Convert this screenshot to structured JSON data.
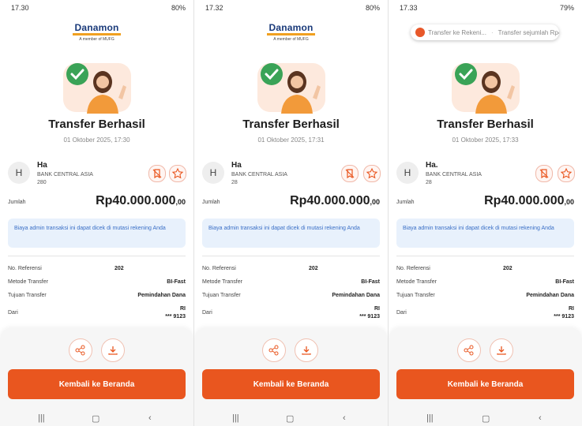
{
  "panels": [
    {
      "status": {
        "time": "17.30",
        "battery": "80%"
      },
      "header_type": "logo",
      "logo": {
        "brand": "Danamon",
        "sub": "A member of MUFG"
      },
      "title": "Transfer Berhasil",
      "datetime": "01 Oktober 2025, 17:30",
      "recipient": {
        "initial": "H",
        "name": "Ha",
        "bank": "BANK CENTRAL ASIA",
        "account": "280"
      },
      "amount_label": "Jumlah",
      "amount": "Rp40.000.000",
      "amount_decimals": ",00",
      "info": "Biaya admin transaksi ini dapat dicek di mutasi rekening Anda",
      "details": {
        "ref_label": "No. Referensi",
        "ref_value": "202",
        "method_label": "Metode Transfer",
        "method_value": "BI-Fast",
        "dest_label": "Tujuan Transfer",
        "dest_value": "Pemindahan Dana",
        "from_label": "Dari",
        "from_line1": "RI",
        "from_line2": "*** 9123"
      },
      "cta": "Kembali ke Beranda"
    },
    {
      "status": {
        "time": "17.32",
        "battery": "80%"
      },
      "header_type": "logo",
      "logo": {
        "brand": "Danamon",
        "sub": "A member of MUFG"
      },
      "title": "Transfer Berhasil",
      "datetime": "01 Oktober 2025, 17:31",
      "recipient": {
        "initial": "H",
        "name": "Ha",
        "bank": "BANK CENTRAL ASIA",
        "account": "28"
      },
      "amount_label": "Jumlah",
      "amount": "Rp40.000.000",
      "amount_decimals": ",00",
      "info": "Biaya admin transaksi ini dapat dicek di mutasi rekening Anda",
      "details": {
        "ref_label": "No. Referensi",
        "ref_value": "202",
        "method_label": "Metode Transfer",
        "method_value": "BI-Fast",
        "dest_label": "Tujuan Transfer",
        "dest_value": "Pemindahan Dana",
        "from_label": "Dari",
        "from_line1": "RI",
        "from_line2": "*** 9123"
      },
      "cta": "Kembali ke Beranda"
    },
    {
      "status": {
        "time": "17.33",
        "battery": "79%"
      },
      "header_type": "toast",
      "toast": {
        "left": "Transfer ke Rekeni...",
        "right": "Transfer sejumlah Rp40"
      },
      "title": "Transfer Berhasil",
      "datetime": "01 Oktober 2025, 17:33",
      "recipient": {
        "initial": "H",
        "name": "Ha.",
        "bank": "BANK CENTRAL ASIA",
        "account": "28"
      },
      "amount_label": "Jumlah",
      "amount": "Rp40.000.000",
      "amount_decimals": ",00",
      "info": "Biaya admin transaksi ini dapat dicek di mutasi rekening Anda",
      "details": {
        "ref_label": "No. Referensi",
        "ref_value": "202",
        "method_label": "Metode Transfer",
        "method_value": "BI-Fast",
        "dest_label": "Tujuan Transfer",
        "dest_value": "Pemindahan Dana",
        "from_label": "Dari",
        "from_line1": "RI",
        "from_line2": "*** 9123"
      },
      "cta": "Kembali ke Beranda"
    }
  ],
  "colors": {
    "accent": "#e9561f",
    "info_bg": "#e8f1fc",
    "info_text": "#3a6fc6",
    "brand": "#1a3a7a",
    "success": "#3aa357"
  }
}
